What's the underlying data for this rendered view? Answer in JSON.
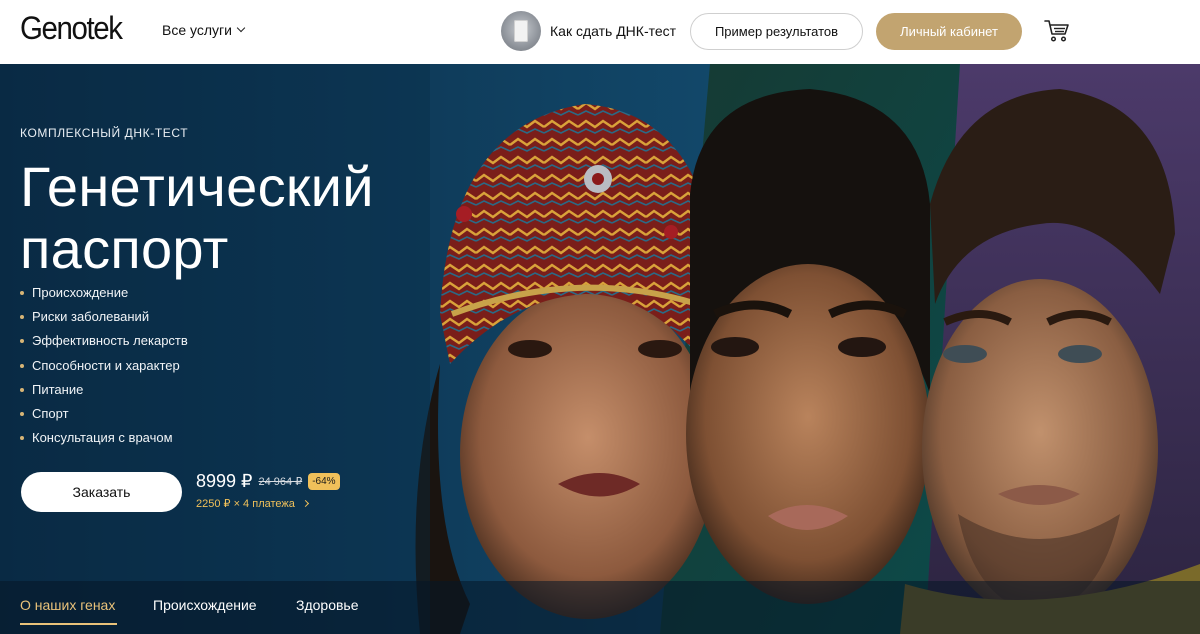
{
  "header": {
    "logo": "Genotek",
    "services_label": "Все услуги",
    "howto_label": "Как сдать ДНК-тест",
    "example_button": "Пример результатов",
    "account_button": "Личный кабинет",
    "cart_icon": "cart-icon",
    "accent_color": "#c2a470"
  },
  "hero": {
    "kicker": "КОМПЛЕКСНЫЙ ДНК-ТЕСТ",
    "title_line1": "Генетический",
    "title_line2": "паспорт",
    "features": [
      "Происхождение",
      "Риски заболеваний",
      "Эффективность лекарств",
      "Способности и характер",
      "Питание",
      "Спорт",
      "Консультация с врачом"
    ],
    "order_button": "Заказать",
    "price": "8999 ₽",
    "old_price": "24 964 ₽",
    "discount": "-64%",
    "installment": "2250 ₽ × 4 платежа",
    "price_accent_color": "#f0c05a"
  },
  "tabs": [
    {
      "label": "О наших генах",
      "active": true
    },
    {
      "label": "Происхождение",
      "active": false
    },
    {
      "label": "Здоровье",
      "active": false
    }
  ]
}
